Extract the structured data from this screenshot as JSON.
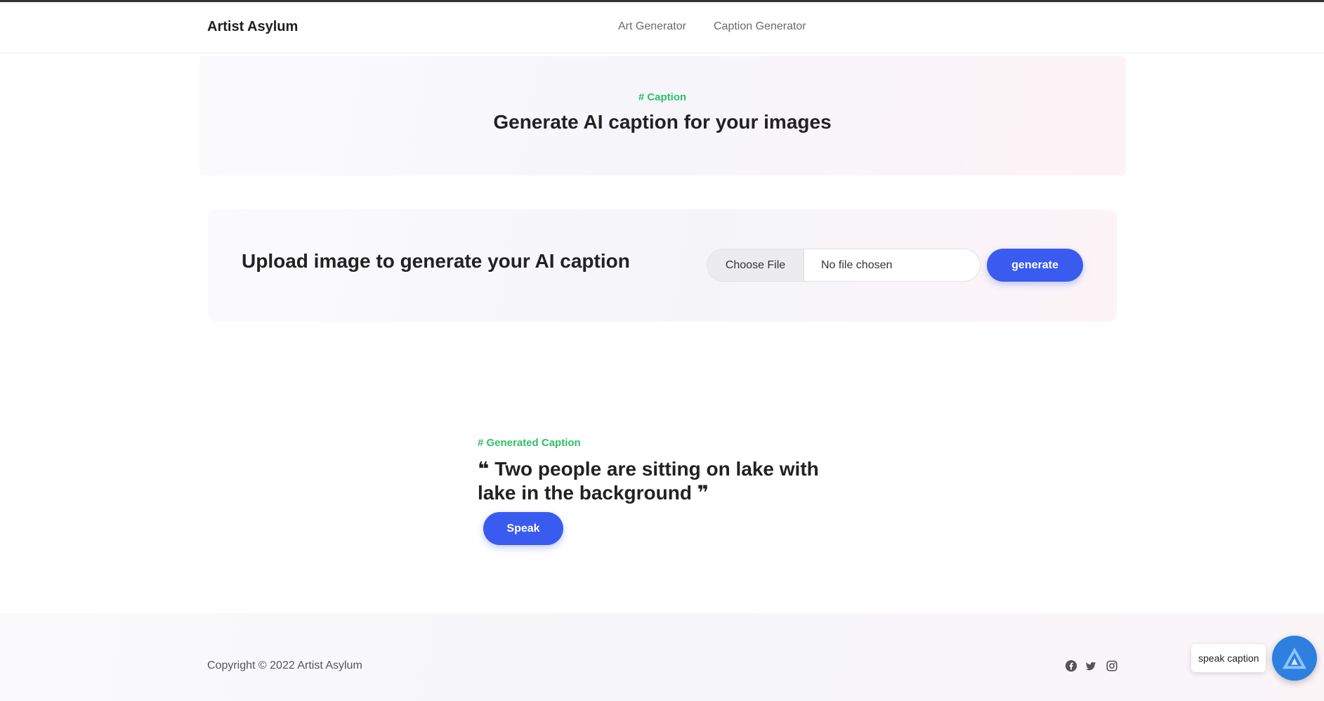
{
  "navbar": {
    "brand": "Artist Asylum",
    "links": [
      "Art Generator",
      "Caption Generator"
    ]
  },
  "hero": {
    "tag": "# Caption",
    "title": "Generate AI caption for your images"
  },
  "upload": {
    "title": "Upload image to generate your AI caption",
    "choose_file_label": "Choose File",
    "file_status": "No file chosen",
    "generate_label": "generate"
  },
  "result": {
    "tag": "# Generated Caption",
    "caption": "❝ Two people are sitting on lake with lake in the background ❞",
    "speak_label": "Speak"
  },
  "footer": {
    "copyright": "Copyright © 2022 Artist Asylum",
    "social_icons": [
      "facebook-icon",
      "twitter-icon",
      "instagram-icon"
    ]
  },
  "widget": {
    "tooltip": "speak caption",
    "icon": "assistant-logo-icon"
  },
  "colors": {
    "accent": "#3a5bef",
    "tag_green": "#2dbf6c",
    "widget_blue": "#2d7fe0"
  }
}
